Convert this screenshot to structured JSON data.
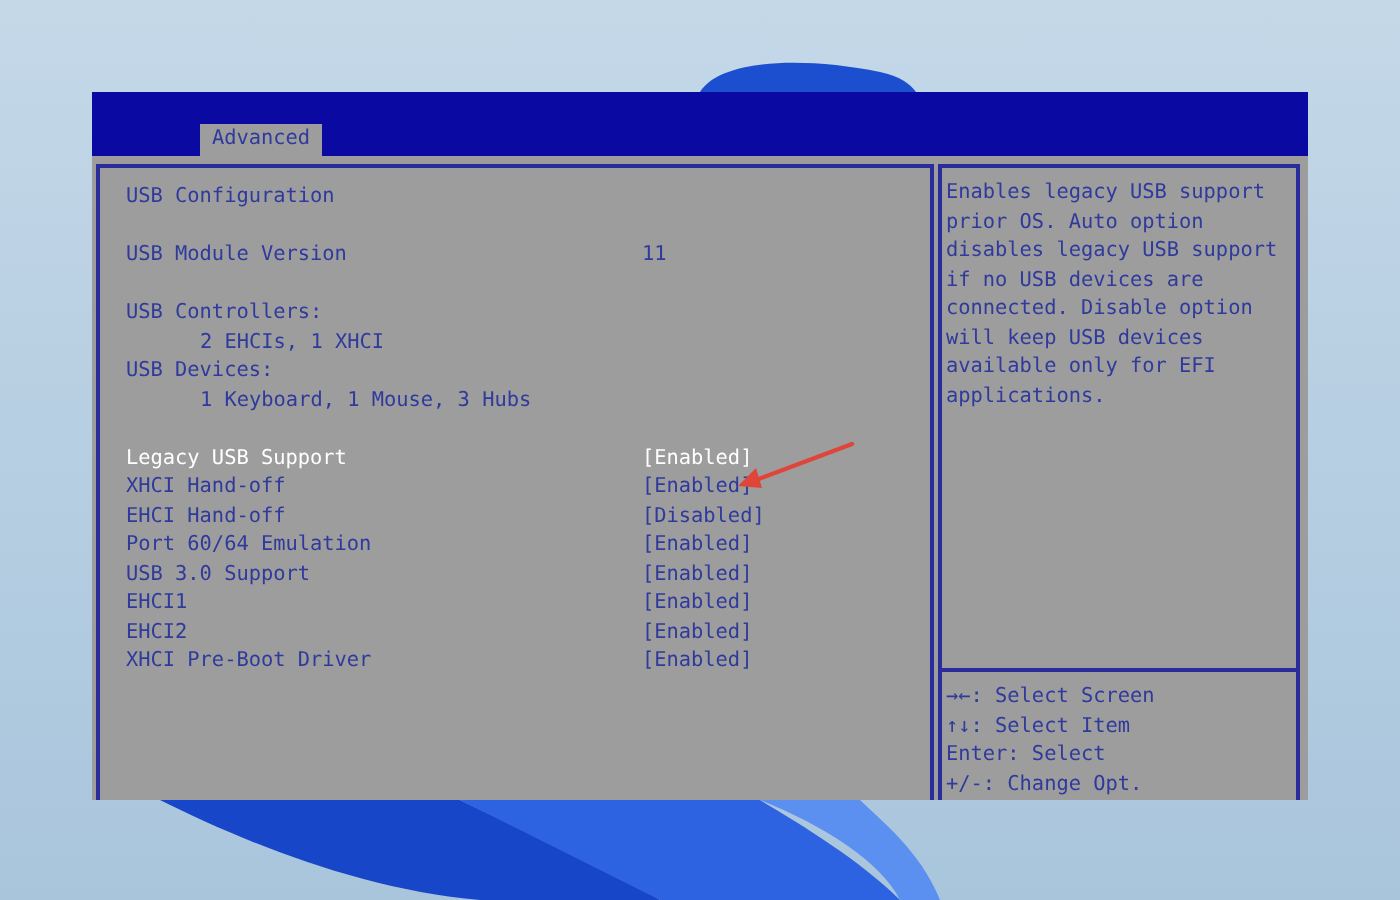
{
  "tabs": [
    {
      "label": "Advanced",
      "selected": true
    }
  ],
  "title": "USB Configuration",
  "module_version": {
    "label": "USB Module Version",
    "value": "11"
  },
  "info_groups": [
    {
      "label": "USB Controllers:",
      "detail": "2 EHCIs, 1 XHCI"
    },
    {
      "label": "USB Devices:",
      "detail": "1 Keyboard, 1 Mouse, 3 Hubs"
    }
  ],
  "settings": [
    {
      "label": "Legacy USB Support",
      "value": "[Enabled]",
      "selected": true
    },
    {
      "label": "XHCI Hand-off",
      "value": "[Enabled]",
      "selected": false
    },
    {
      "label": "EHCI Hand-off",
      "value": "[Disabled]",
      "selected": false
    },
    {
      "label": "Port 60/64 Emulation",
      "value": "[Enabled]",
      "selected": false
    },
    {
      "label": "USB 3.0 Support",
      "value": "[Enabled]",
      "selected": false
    },
    {
      "label": "EHCI1",
      "value": "[Enabled]",
      "selected": false
    },
    {
      "label": "EHCI2",
      "value": "[Enabled]",
      "selected": false
    },
    {
      "label": "XHCI Pre-Boot Driver",
      "value": "[Enabled]",
      "selected": false
    }
  ],
  "help": "Enables legacy USB support prior OS. Auto option disables legacy USB support if no USB devices are connected. Disable option will keep USB devices available only for EFI applications.",
  "key_hints": [
    {
      "key": "→←:",
      "action": "Select Screen"
    },
    {
      "key": "↑↓:",
      "action": "Select Item"
    },
    {
      "key": "Enter:",
      "action": "Select"
    },
    {
      "key": "+/-:",
      "action": "Change Opt."
    }
  ]
}
